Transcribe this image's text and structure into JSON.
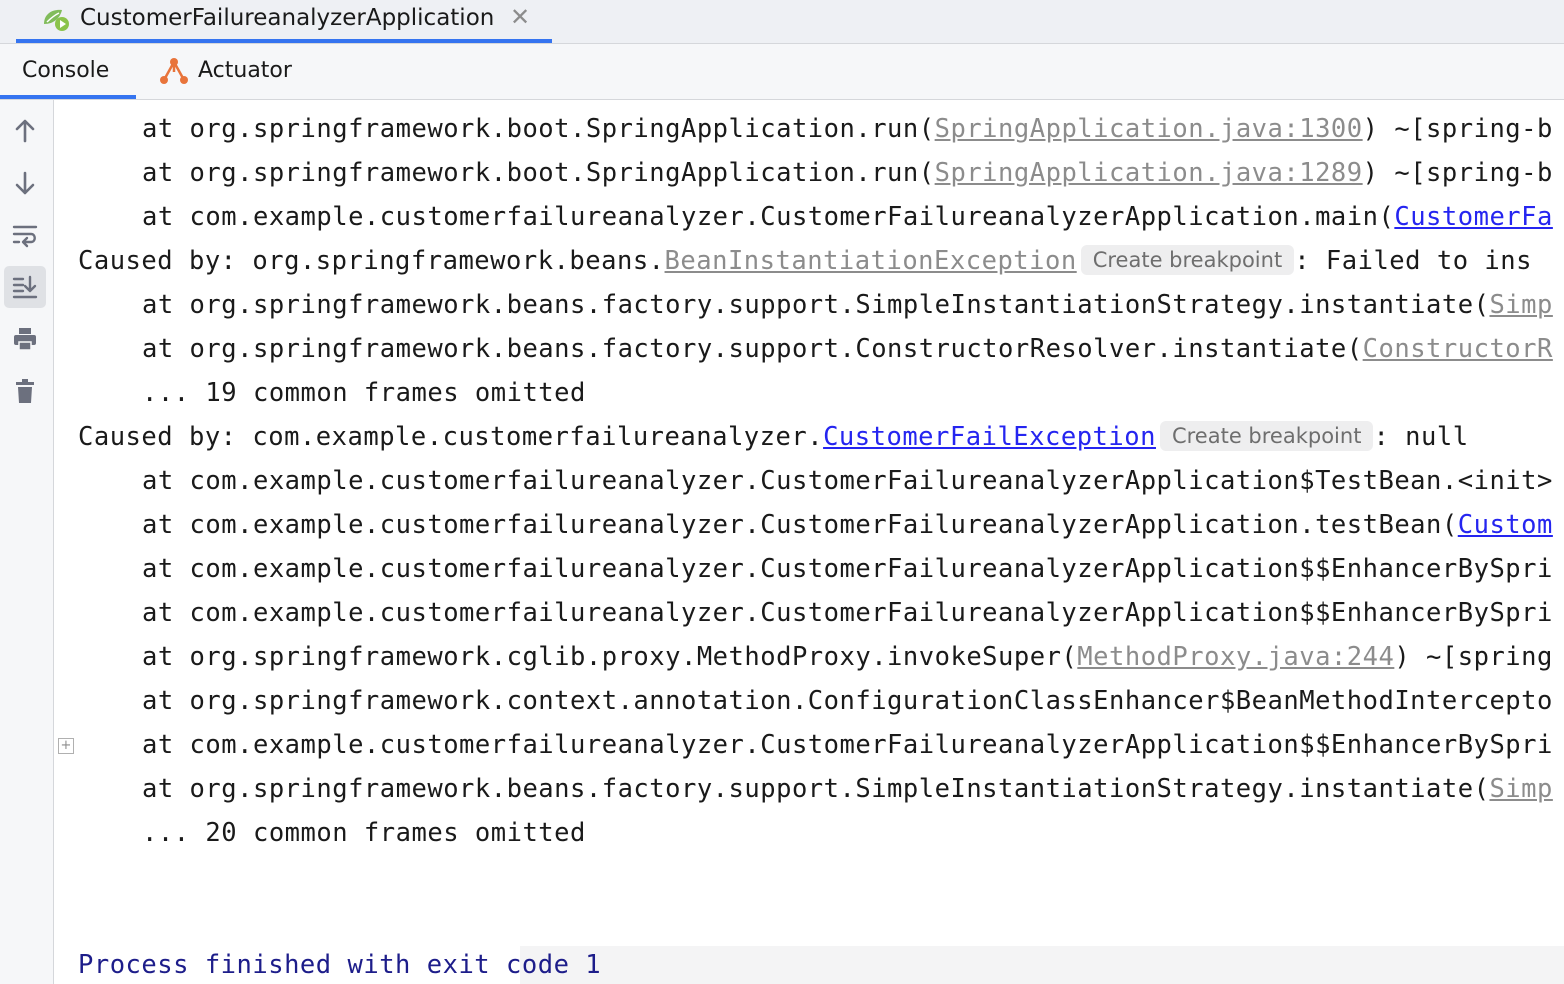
{
  "run_tab": {
    "title": "CustomerFailureanalyzerApplication",
    "close_glyph": "✕",
    "icon": "spring-boot-run-icon"
  },
  "tabs": [
    {
      "label": "Console",
      "active": true
    },
    {
      "label": "Actuator",
      "icon": "actuator-icon"
    }
  ],
  "toolbar": [
    {
      "name": "scroll-up-icon"
    },
    {
      "name": "scroll-down-icon"
    },
    {
      "name": "soft-wrap-icon"
    },
    {
      "name": "scroll-to-end-icon",
      "active": true
    },
    {
      "name": "print-icon"
    },
    {
      "name": "clear-all-icon"
    }
  ],
  "console": {
    "breakpoint_label": "Create breakpoint",
    "lines": [
      {
        "pre": "at org.springframework.boot.SpringApplication.run(",
        "link": "SpringApplication.java:1300",
        "post": ") ~[spring-b"
      },
      {
        "pre": "at org.springframework.boot.SpringApplication.run(",
        "link": "SpringApplication.java:1289",
        "post": ") ~[spring-b"
      },
      {
        "pre": "at com.example.customerfailureanalyzer.CustomerFailureanalyzerApplication.main(",
        "link": "CustomerFa",
        "post": ""
      },
      {
        "pre": "Caused by: org.springframework.beans.",
        "link": "BeanInstantiationException",
        "post": ": Failed to ins"
      },
      {
        "pre": "at org.springframework.beans.factory.support.SimpleInstantiationStrategy.instantiate(",
        "link": "Simp",
        "post": ""
      },
      {
        "pre": "at org.springframework.beans.factory.support.ConstructorResolver.instantiate(",
        "link": "ConstructorR",
        "post": ""
      },
      {
        "pre": "... 19 common frames omitted",
        "link": "",
        "post": ""
      },
      {
        "pre": "Caused by: com.example.customerfailureanalyzer.",
        "link": "CustomerFailException",
        "post": ": null"
      },
      {
        "pre": "at com.example.customerfailureanalyzer.CustomerFailureanalyzerApplication$TestBean.<init>",
        "link": "",
        "post": ""
      },
      {
        "pre": "at com.example.customerfailureanalyzer.CustomerFailureanalyzerApplication.testBean(",
        "link": "Custom",
        "post": ""
      },
      {
        "pre": "at com.example.customerfailureanalyzer.CustomerFailureanalyzerApplication$$EnhancerBySpri",
        "link": "",
        "post": ""
      },
      {
        "pre": "at com.example.customerfailureanalyzer.CustomerFailureanalyzerApplication$$EnhancerBySpri",
        "link": "",
        "post": ""
      },
      {
        "pre": "at org.springframework.cglib.proxy.MethodProxy.invokeSuper(",
        "link": "MethodProxy.java:244",
        "post": ") ~[spring"
      },
      {
        "pre": "at org.springframework.context.annotation.ConfigurationClassEnhancer$BeanMethodIntercepto",
        "link": "",
        "post": ""
      },
      {
        "pre": "at com.example.customerfailureanalyzer.CustomerFailureanalyzerApplication$$EnhancerBySpri",
        "link": "",
        "post": ""
      },
      {
        "pre": "at org.springframework.beans.factory.support.SimpleInstantiationStrategy.instantiate(",
        "link": "Simp",
        "post": ""
      },
      {
        "pre": "... 20 common frames omitted",
        "link": "",
        "post": ""
      }
    ],
    "exit_message": "Process finished with exit code 1",
    "colors": {
      "link_blue": "#2525f0",
      "link_gray": "#8c8c8c",
      "exit_text": "#1d1d8a",
      "tab_accent": "#3574f0"
    }
  }
}
